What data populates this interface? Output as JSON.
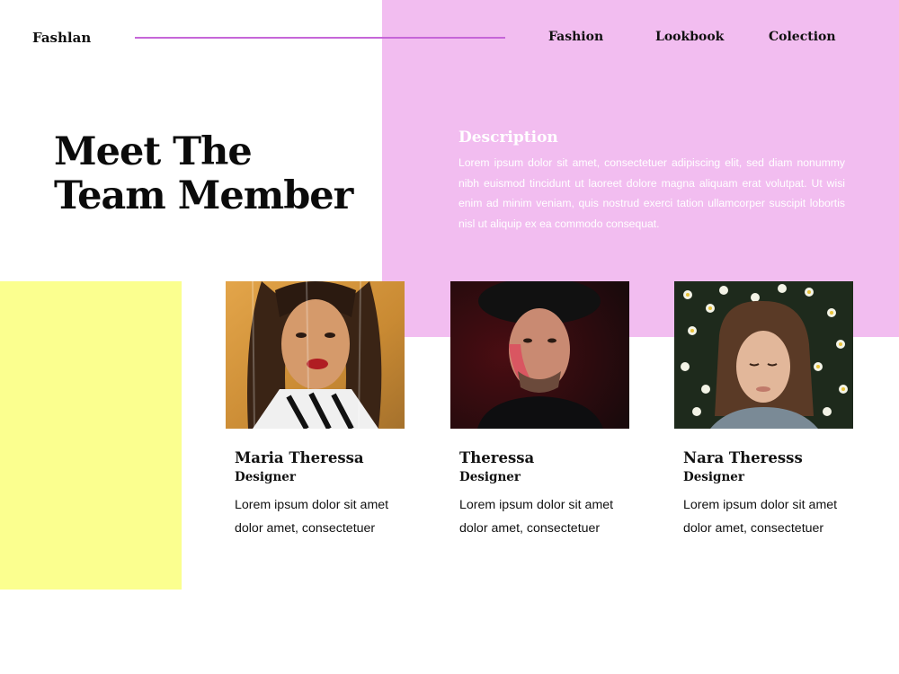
{
  "header": {
    "brand": "Fashlan",
    "nav": [
      "Fashion",
      "Lookbook",
      "Colection"
    ]
  },
  "hero": {
    "title_line1": "Meet The",
    "title_line2": "Team Member"
  },
  "description": {
    "heading": "Description",
    "text": "Lorem ipsum dolor sit amet, consectetuer adipiscing elit, sed diam nonummy nibh euismod tincidunt ut laoreet dolore magna aliquam erat volutpat. Ut wisi enim ad minim veniam, quis nostrud exerci tation ullamcorper suscipit lobortis nisl ut aliquip ex ea commodo consequat."
  },
  "team": [
    {
      "name": "Maria Theressa",
      "role": "Designer",
      "bio": "Lorem ipsum dolor sit amet dolor amet, consectetuer"
    },
    {
      "name": "Theressa",
      "role": "Designer",
      "bio": "Lorem ipsum dolor sit amet dolor amet, consectetuer"
    },
    {
      "name": "Nara Theresss",
      "role": "Designer",
      "bio": "Lorem ipsum dolor sit amet dolor amet, consectetuer"
    }
  ],
  "colors": {
    "pink": "#f2bdf0",
    "yellow": "#fbff8f",
    "accent_line": "#c666d8",
    "text": "#111111"
  }
}
